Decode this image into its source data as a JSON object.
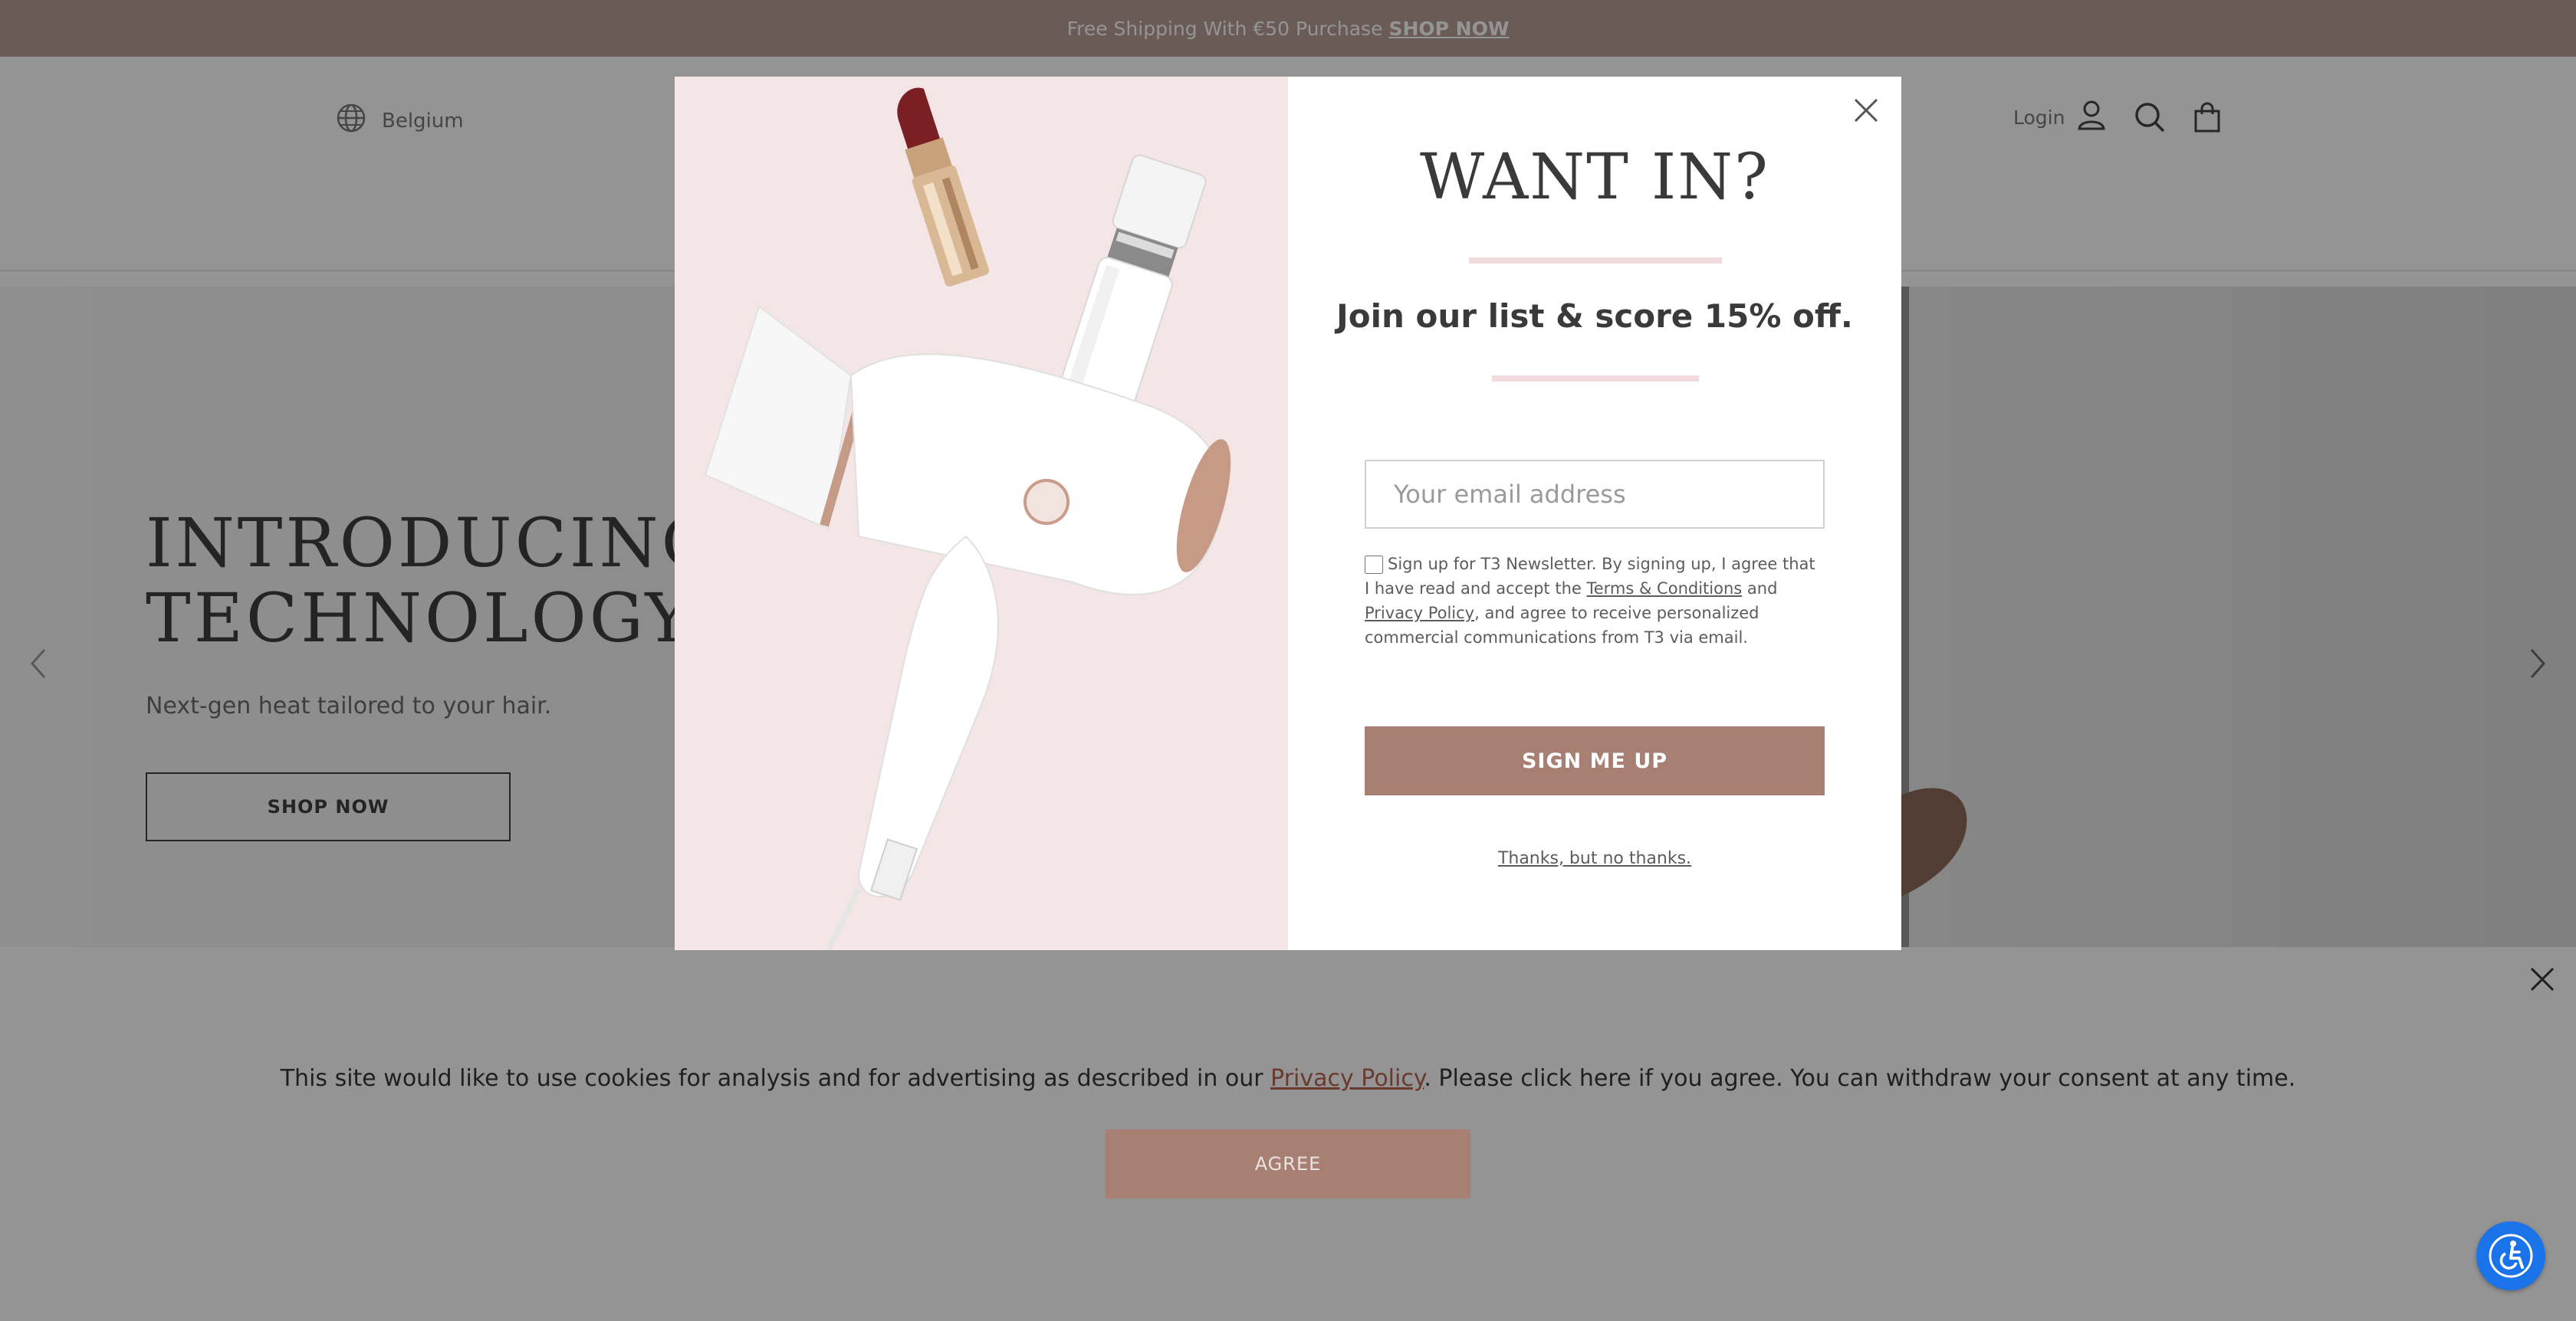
{
  "announcement": {
    "text": "Free Shipping With €50 Purchase",
    "link": "SHOP NOW"
  },
  "header": {
    "locale": "Belgium",
    "login": "Login"
  },
  "hero": {
    "title": "INTRODUCING T\nTECHNOLOGY",
    "subtitle": "Next-gen heat tailored to your hair.",
    "button": "SHOP NOW"
  },
  "modal": {
    "title": "WANT IN?",
    "subtitle": "Join our list & score 15% off.",
    "email_placeholder": "Your email address",
    "consent": {
      "part1": "Sign up for T3 Newsletter. By signing up, I agree that I have read and accept the ",
      "terms_link": "Terms & Conditions",
      "part2": " and ",
      "privacy_link": "Privacy Policy",
      "part3": ", and agree to receive personalized commercial communications from T3 via email."
    },
    "signup_button": "SIGN ME UP",
    "decline_link": "Thanks, but no thanks."
  },
  "cookie": {
    "text_before": "This site would like to use cookies for analysis and for advertising as described in our ",
    "privacy_link": "Privacy Policy",
    "text_after": ". Please click here if you agree. You can withdraw your consent at any time.",
    "agree_button": "AGREE"
  },
  "colors": {
    "announcement_bg": "#b99d95",
    "accent": "#a77f73",
    "modal_image_bg": "#f4e5e6",
    "accessibility_button": "#1a73e8"
  },
  "icons": [
    "globe-icon",
    "user-icon",
    "search-icon",
    "cart-icon",
    "close-icon",
    "chevron-left-icon",
    "chevron-right-icon",
    "accessibility-icon"
  ]
}
